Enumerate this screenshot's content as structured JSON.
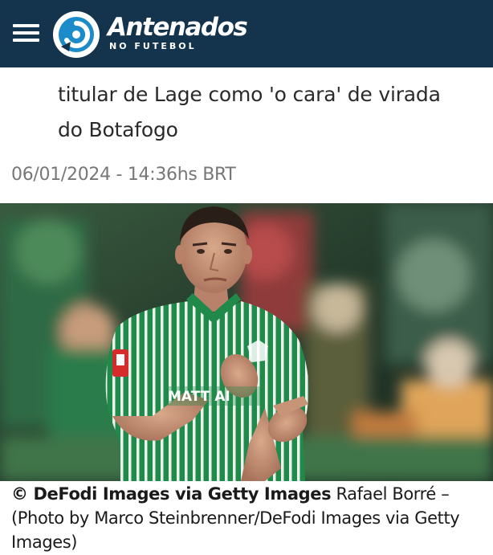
{
  "header": {
    "brand_name": "Antenados",
    "brand_subtitle": "NO FUTEBOL",
    "menu_icon": "hamburger-menu-icon",
    "logo_icon": "antenados-logo-icon",
    "background_color": "#14334d"
  },
  "article": {
    "title_lines": [
      "titular de Lage como 'o cara' de virada",
      "do Botafogo"
    ],
    "date": "06/01/2024 - 14:36hs BRT"
  },
  "photo": {
    "caption_credit": "© DeFodi Images via Getty Images",
    "caption_text": "Rafael Borré – (Photo by Marco Steinbrenner/DeFodi Images via Getty Images)",
    "jersey_sponsor": "MATT AI"
  }
}
